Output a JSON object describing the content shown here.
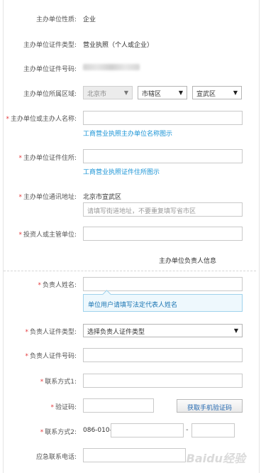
{
  "org_type": {
    "label": "主办单位性质:",
    "value": "企业"
  },
  "cert_type": {
    "label": "主办单位证件类型:",
    "value": "营业执照（个人或企业）"
  },
  "cert_no": {
    "label": "主办单位证件号码:"
  },
  "region": {
    "label": "主办单位所属区域:",
    "province": "北京市",
    "city": "市辖区",
    "district": "宣武区"
  },
  "org_name": {
    "required": "*",
    "label": "主办单位或主办人名称:",
    "link": "工商营业执照主办单位名称图示"
  },
  "cert_addr": {
    "required": "*",
    "label": "主办单位证件住所:",
    "link": "工商营业执照证件住所图示"
  },
  "mail_addr": {
    "required": "*",
    "label": "主办单位通讯地址:",
    "prefix": "北京市宣武区",
    "placeholder": "请填写街道地址，不要重复填写省市区"
  },
  "investor": {
    "required": "*",
    "label": "投资人或主管单位:"
  },
  "section_title": "主办单位负责人信息",
  "person_name": {
    "required": "*",
    "label": "负责人姓名:",
    "tip": "单位用户请填写法定代表人姓名"
  },
  "person_cert_type": {
    "required": "*",
    "label": "负责人证件类型:",
    "value": "选择负责人证件类型"
  },
  "person_cert_no": {
    "required": "*",
    "label": "负责人证件号码:"
  },
  "contact1": {
    "required": "*",
    "label": "联系方式1:"
  },
  "verify_code": {
    "required": "*",
    "label": "验证码:",
    "button": "获取手机验证码"
  },
  "contact2": {
    "required": "*",
    "label": "联系方式2:",
    "prefix": "086-010-",
    "separator": "-"
  },
  "emergency": {
    "label": "应急联系电话:"
  },
  "watermark": "Baidu经验"
}
